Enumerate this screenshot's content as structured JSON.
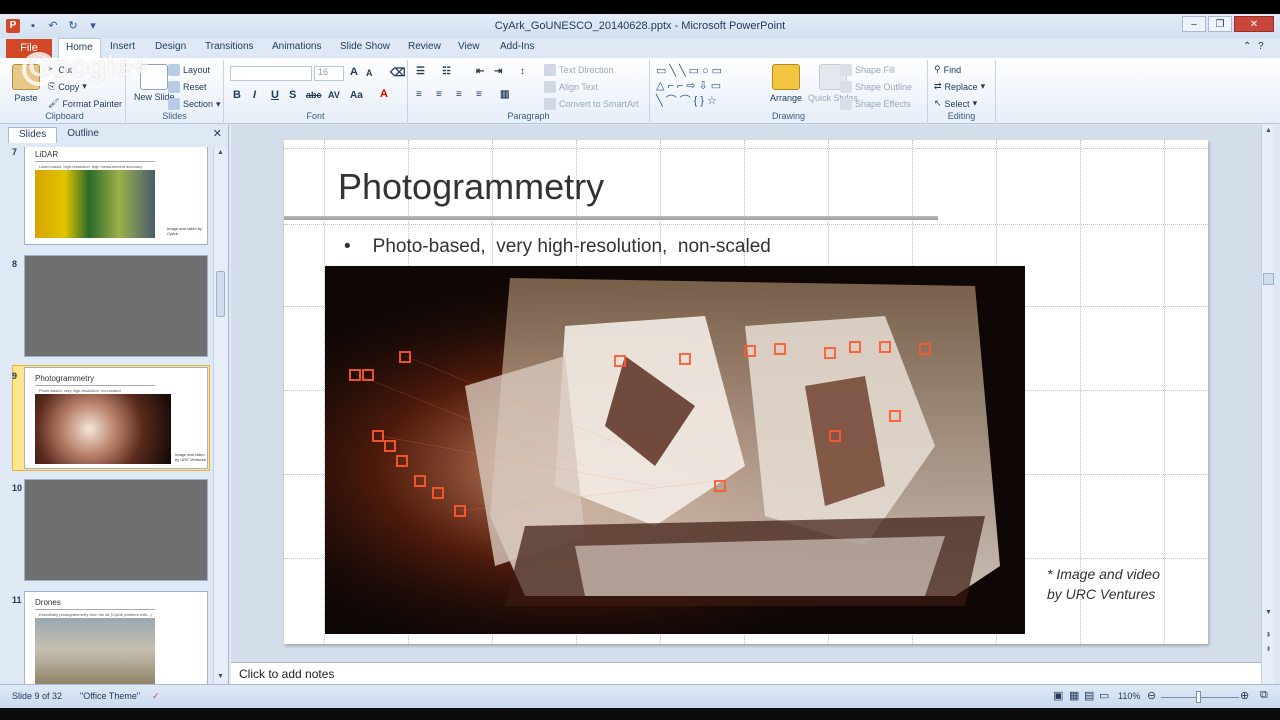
{
  "window": {
    "title": "CyArk_GoUNESCO_20140628.pptx - Microsoft PowerPoint",
    "app_letter": "P"
  },
  "watermark": "Google+",
  "ribbon": {
    "file_tab": "File",
    "tabs": [
      "Home",
      "Insert",
      "Design",
      "Transitions",
      "Animations",
      "Slide Show",
      "Review",
      "View",
      "Add-Ins"
    ],
    "active_tab": "Home",
    "clipboard": {
      "paste": "Paste",
      "cut": "Cut",
      "copy": "Copy",
      "format_painter": "Format Painter",
      "label": "Clipboard"
    },
    "slides": {
      "new_slide": "New Slide",
      "layout": "Layout",
      "reset": "Reset",
      "section": "Section",
      "label": "Slides"
    },
    "font": {
      "size": "16",
      "bold": "B",
      "italic": "I",
      "underline": "U",
      "strike": "abc",
      "shadow": "S",
      "spacing": "AV",
      "case": "Aa",
      "grow": "A",
      "shrink": "A",
      "label": "Font"
    },
    "paragraph": {
      "text_direction": "Text Direction",
      "align_text": "Align Text",
      "convert_smartart": "Convert to SmartArt",
      "label": "Paragraph"
    },
    "drawing": {
      "arrange": "Arrange",
      "quick_styles": "Quick Styles",
      "shape_fill": "Shape Fill",
      "shape_outline": "Shape Outline",
      "shape_effects": "Shape Effects",
      "label": "Drawing"
    },
    "editing": {
      "find": "Find",
      "replace": "Replace",
      "select": "Select",
      "label": "Editing"
    }
  },
  "pane": {
    "tabs": [
      "Slides",
      "Outline"
    ],
    "active": "Slides",
    "thumbnails": [
      {
        "num": "7",
        "title": "LiDAR",
        "bullet": "Laser-based, high-resolution, high measurement accuracy",
        "caption": "Image and video by CyArk",
        "type": "content"
      },
      {
        "num": "8",
        "title": "",
        "type": "blank"
      },
      {
        "num": "9",
        "title": "Photogrammetry",
        "bullet": "Photo-based, very high-resolution, non-scaled",
        "caption": "Image and video by URC Ventures",
        "type": "content",
        "selected": true
      },
      {
        "num": "10",
        "title": "",
        "type": "blank"
      },
      {
        "num": "11",
        "title": "Drones",
        "bullet": "Essentially photogrammetry from the air (CyArk partners with...)",
        "caption": "",
        "type": "content"
      }
    ]
  },
  "slide": {
    "title": "Photogrammetry",
    "bullet_mark": "•",
    "bullet": "Photo-based,  very high-resolution,  non-scaled",
    "caption_line1": "* Image and video",
    "caption_line2": "by URC Ventures"
  },
  "notes_placeholder": "Click to add notes",
  "status": {
    "slide_indicator": "Slide 9 of 32",
    "theme": "\"Office Theme\"",
    "zoom": "110%"
  },
  "colors": {
    "file_tab": "#d24726",
    "ribbon_bg": "#dfe9f5",
    "selected_thumb": "#ffe58b",
    "accent_red": "#c9463d"
  }
}
